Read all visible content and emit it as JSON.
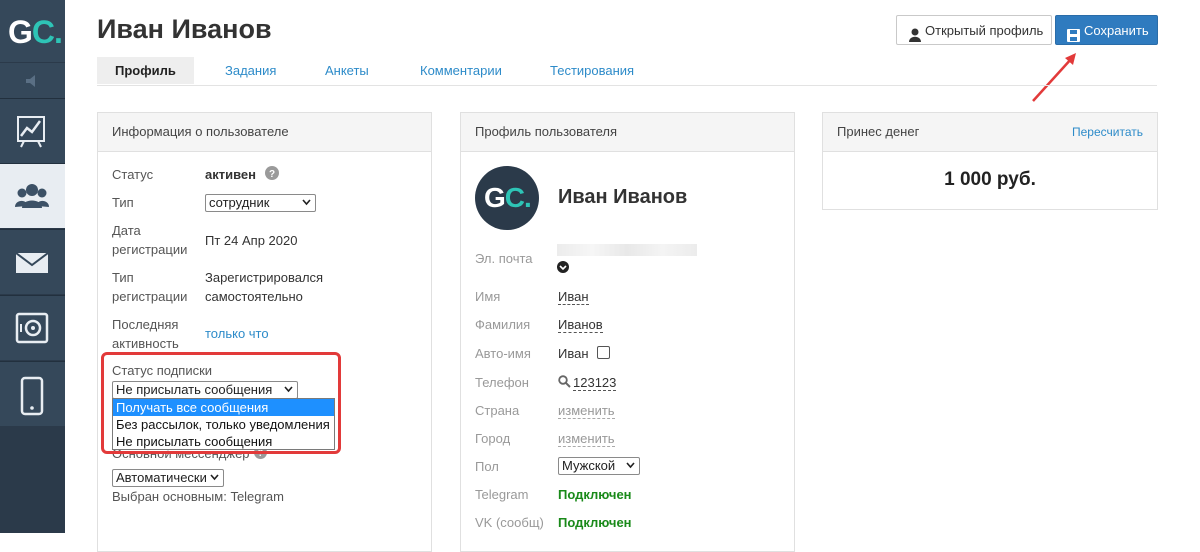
{
  "sidebar": {
    "logo_g": "G",
    "logo_c": "C.",
    "items": [
      {
        "icon": "chart-icon"
      },
      {
        "icon": "users-icon",
        "active": true
      },
      {
        "icon": "mail-icon"
      },
      {
        "icon": "safe-icon"
      },
      {
        "icon": "phone-icon"
      }
    ]
  },
  "header": {
    "title": "Иван Иванов",
    "open_profile_label": "Открытый профиль",
    "save_label": "Сохранить"
  },
  "tabs": [
    "Профиль",
    "Задания",
    "Анкеты",
    "Комментарии",
    "Тестирования"
  ],
  "user_info": {
    "title": "Информация о пользователе",
    "status_label": "Статус",
    "status_value": "активен",
    "type_label": "Тип",
    "type_value": "сотрудник",
    "reg_date_label_1": "Дата",
    "reg_date_label_2": "регистрации",
    "reg_date_value": "Пт 24 Апр 2020",
    "reg_type_label_1": "Тип",
    "reg_type_label_2": "регистрации",
    "reg_type_value_1": "Зарегистрировался",
    "reg_type_value_2": "самостоятельно",
    "last_active_label_1": "Последняя",
    "last_active_label_2": "активность",
    "last_active_value": "только что",
    "subscription_label": "Статус подписки",
    "subscription_value": "Не присылать сообщения",
    "subscription_options": [
      "Получать все сообщения",
      "Без рассылок, только уведомления",
      "Не присылать сообщения"
    ],
    "messenger_label": "Основной мессенджер",
    "messenger_value": "Автоматически",
    "messenger_selected": "Выбран основным: Telegram"
  },
  "user_profile": {
    "title": "Профиль пользователя",
    "name": "Иван Иванов",
    "email_label": "Эл. почта",
    "first_name_label": "Имя",
    "first_name_value": "Иван",
    "last_name_label": "Фамилия",
    "last_name_value": "Иванов",
    "auto_name_label": "Авто-имя",
    "auto_name_value": "Иван",
    "phone_label": "Телефон",
    "phone_value": "123123",
    "country_label": "Страна",
    "country_value": "изменить",
    "city_label": "Город",
    "city_value": "изменить",
    "gender_label": "Пол",
    "gender_value": "Мужской",
    "telegram_label": "Telegram",
    "telegram_value": "Подключен",
    "vk_label": "VK (сообщ)",
    "vk_value": "Подключен"
  },
  "money": {
    "title": "Принес денег",
    "recalc_label": "Пересчитать",
    "amount": "1 000 руб."
  },
  "colors": {
    "sidebar_bg": "#2b3a4a",
    "accent": "#2f7bbf",
    "logo_accent": "#2ec4b6",
    "highlight": "#e23a3a",
    "status_ok": "#1a8a1a"
  }
}
